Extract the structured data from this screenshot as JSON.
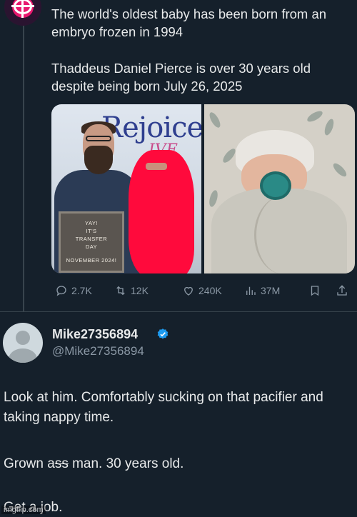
{
  "original_tweet": {
    "headline": "The world's oldest baby has been born from an embryo frozen in 1994",
    "detail": "Thaddeus Daniel Pierce is over 30 years old despite being born July 26, 2025",
    "photo_left": {
      "sign_text": "Rejoice",
      "sign_sub": "IVF La",
      "letterboard_lines": [
        "YAY!",
        "IT'S",
        "TRANSFER",
        "DAY",
        "NOVEMBER 2024!"
      ]
    },
    "actions": {
      "replies": "2.7K",
      "retweets": "12K",
      "likes": "240K",
      "views": "37M"
    }
  },
  "reply": {
    "display_name": "Mike27356894",
    "handle": "@Mike27356894",
    "line1": "Look at him. Comfortably sucking on that pacifier and taking nappy time.",
    "line2_a": "Grown a",
    "line2_strike": "ss",
    "line2_b": " man. 30 years old.",
    "line3": "Get a job."
  },
  "watermark": "imgflip.com",
  "colors": {
    "background": "#15202b",
    "text": "#e7e9ea",
    "muted": "#8b98a5",
    "verified": "#1d9bf0",
    "redaction": "#ff0a3c"
  }
}
